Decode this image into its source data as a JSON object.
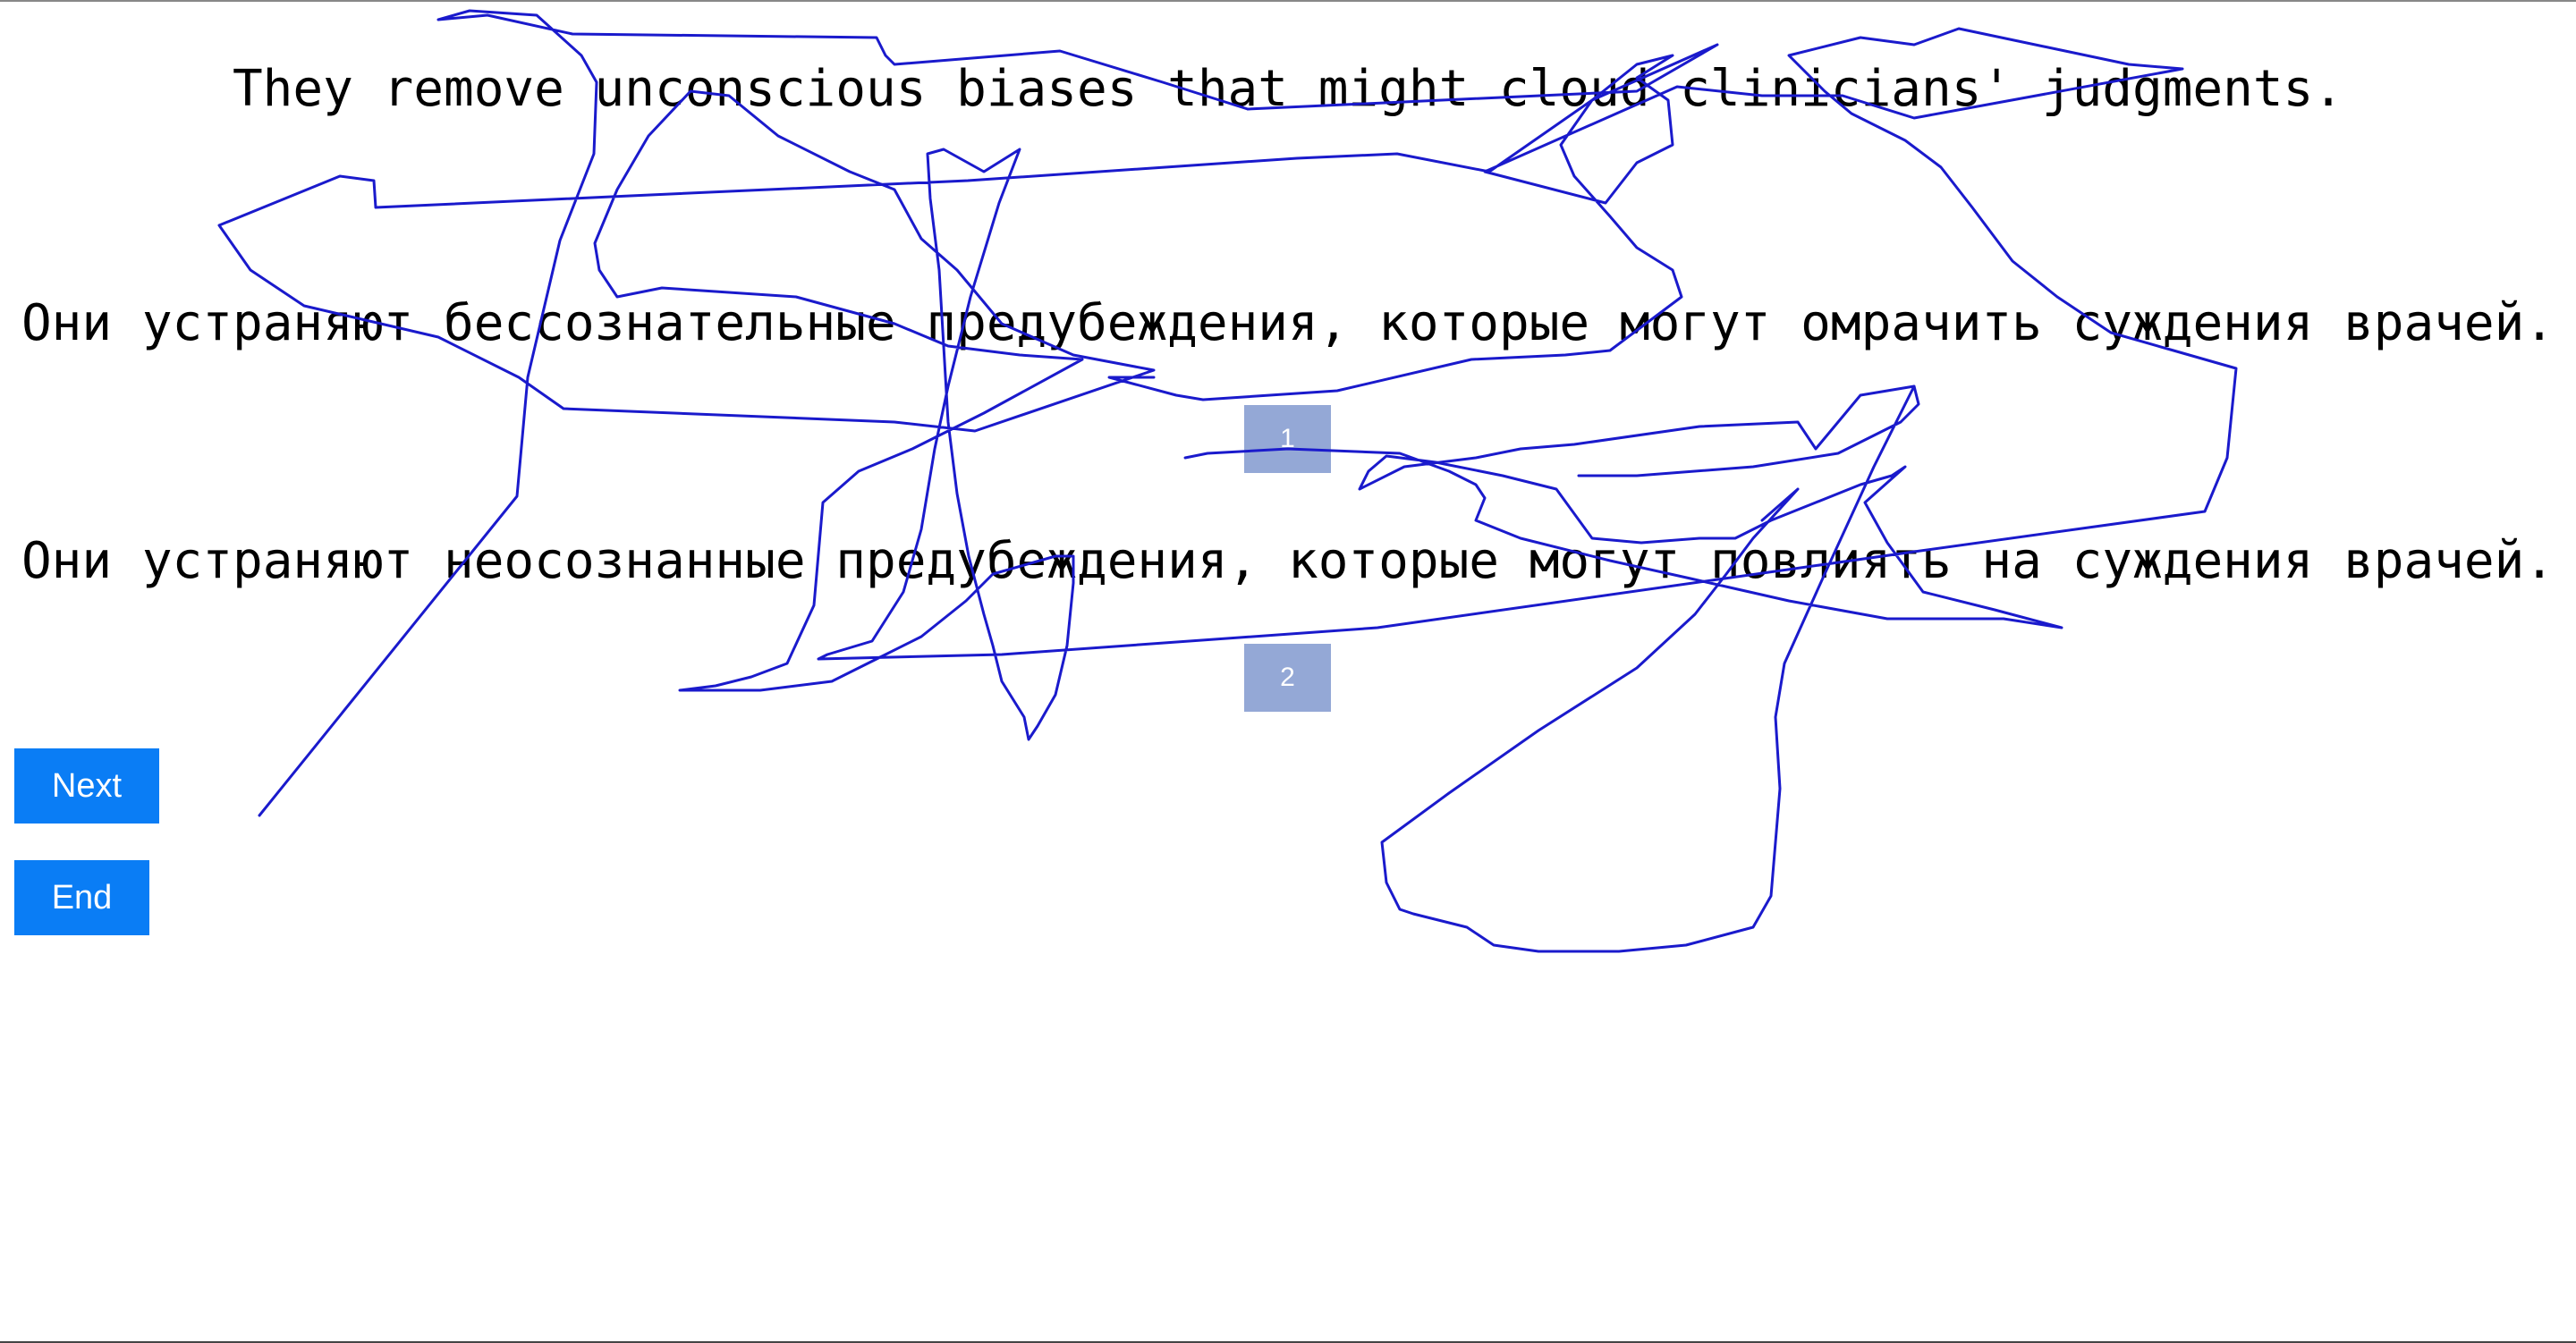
{
  "source": {
    "sentence": "They remove unconscious biases that might cloud clinicians' judgments."
  },
  "options": [
    {
      "sentence": "Они устраняют бессознательные предубеждения, которые могут омрачить суждения врачей.",
      "button_label": "1"
    },
    {
      "sentence": "Они устраняют неосознанные предубеждения, которые могут повлиять на суждения врачей.",
      "button_label": "2"
    }
  ],
  "controls": {
    "next_label": "Next",
    "end_label": "End"
  },
  "colors": {
    "option_button": "#94a8d6",
    "action_button": "#0a7df5",
    "scribble_stroke": "#1a1acc"
  }
}
